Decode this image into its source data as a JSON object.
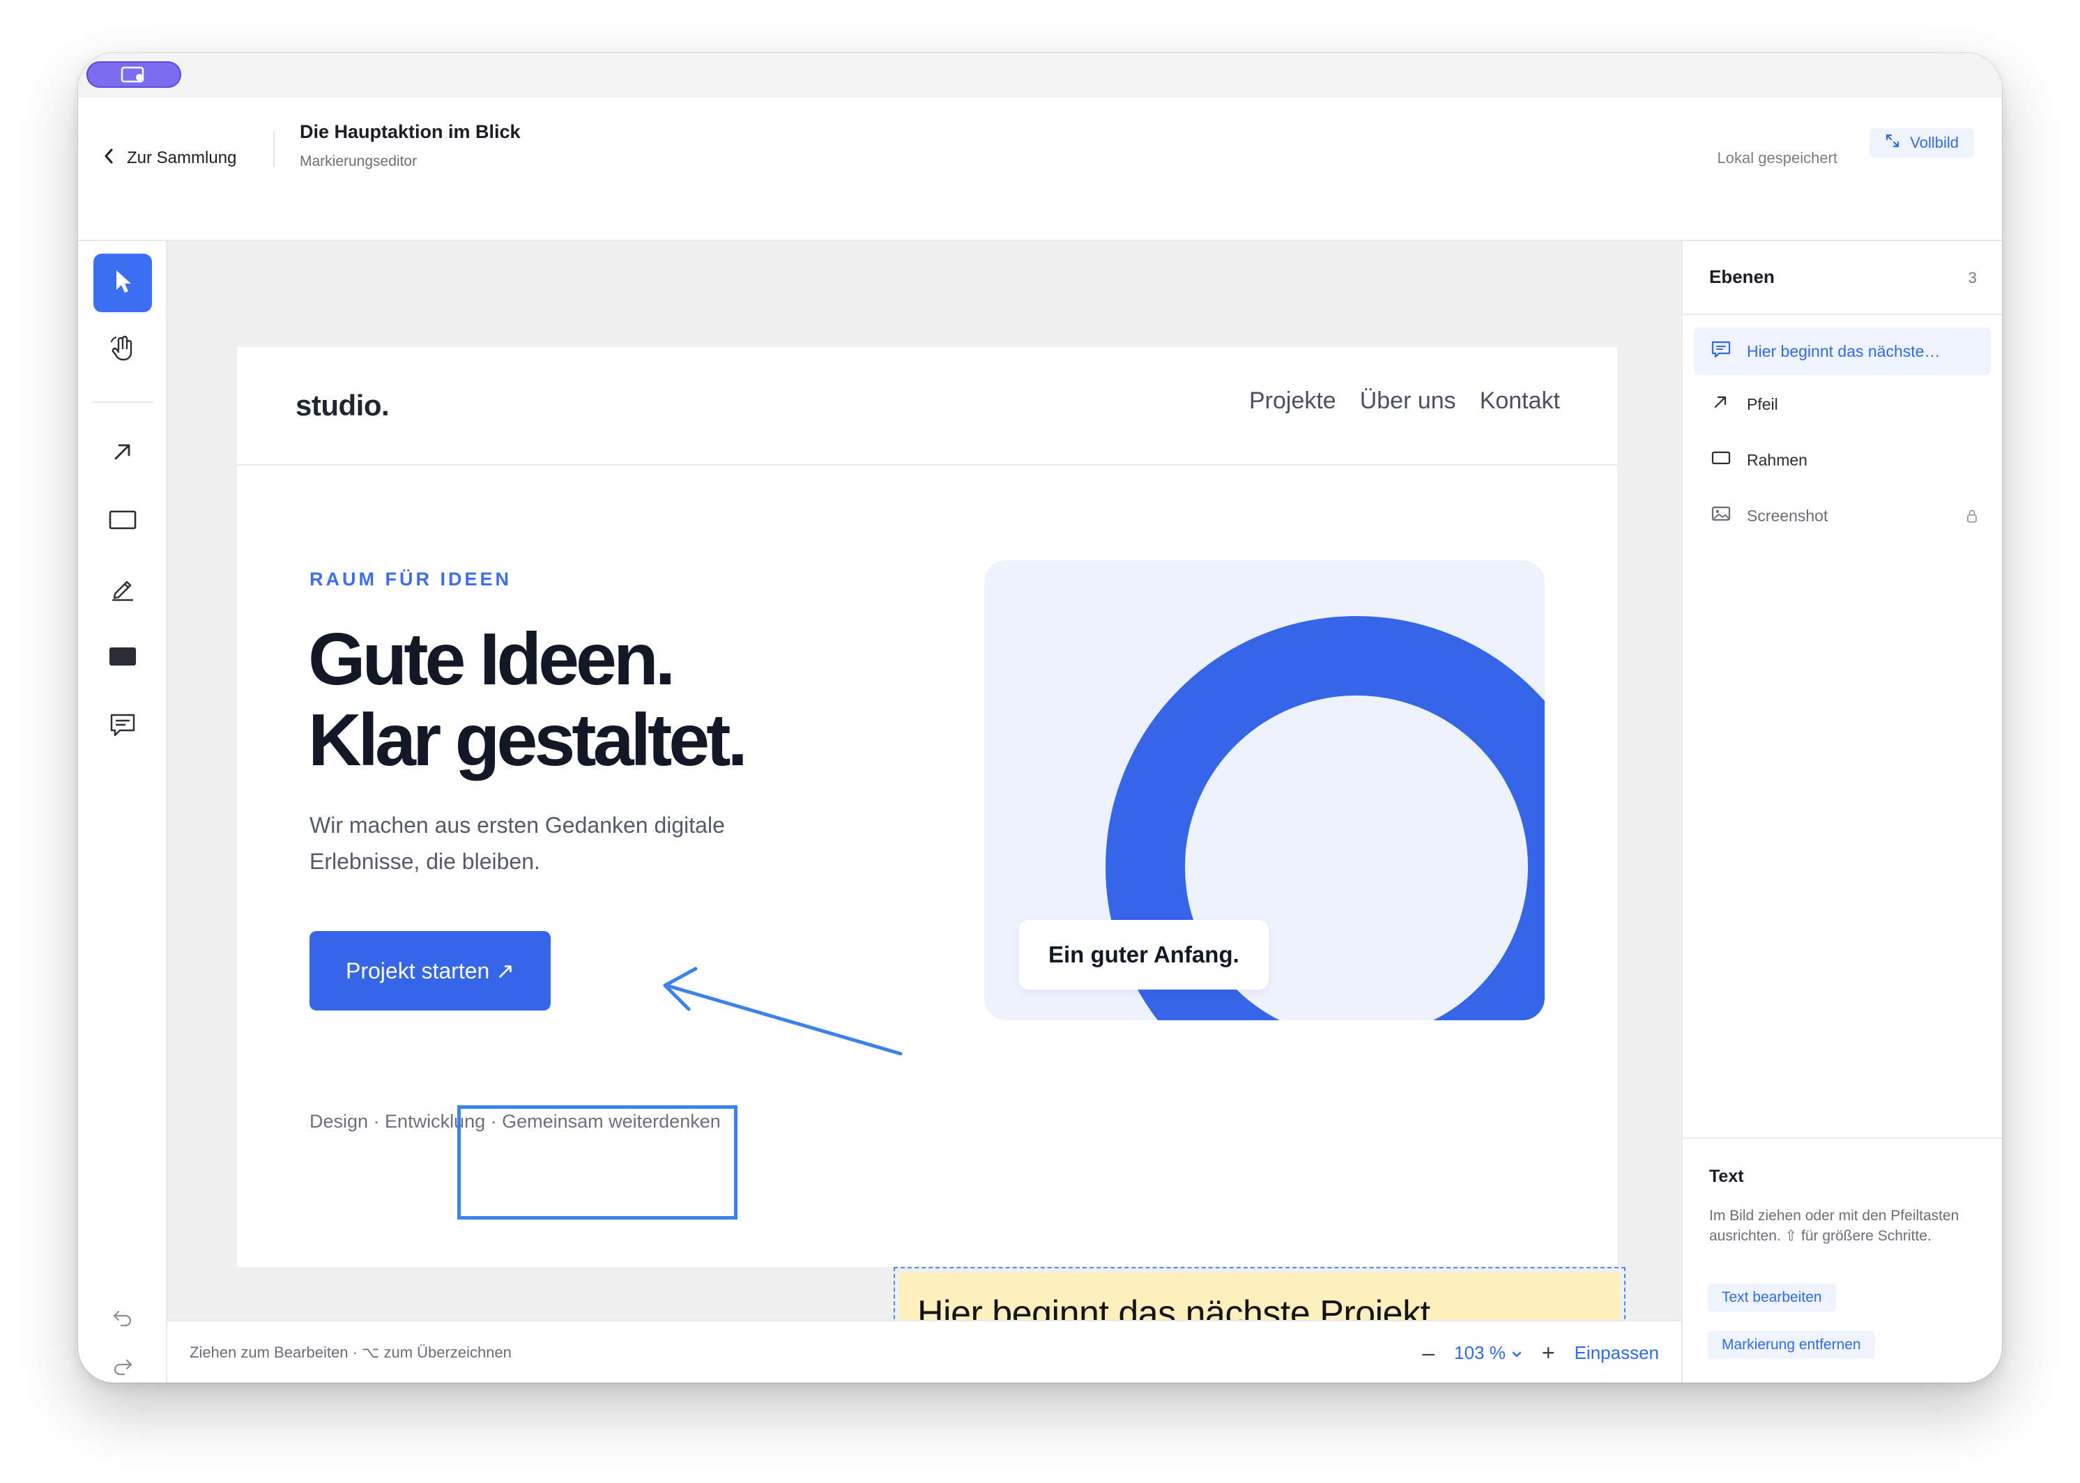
{
  "header": {
    "back_label": "Zur Sammlung",
    "doc_title": "Die Hauptaktion im Blick",
    "doc_subtitle": "Markierungseditor",
    "save_status": "Lokal gespeichert",
    "fullscreen_label": "Vollbild"
  },
  "tools": [
    {
      "name": "select",
      "icon": "cursor-icon",
      "active": true
    },
    {
      "name": "pan",
      "icon": "hand-icon",
      "active": false
    },
    {
      "name": "arrow",
      "icon": "arrow-icon",
      "active": false
    },
    {
      "name": "rectangle",
      "icon": "rectangle-icon",
      "active": false
    },
    {
      "name": "pen",
      "icon": "pen-icon",
      "active": false
    },
    {
      "name": "redact",
      "icon": "filled-rectangle-icon",
      "active": false
    },
    {
      "name": "comment",
      "icon": "comment-icon",
      "active": false
    }
  ],
  "page": {
    "brand": "studio.",
    "nav": [
      "Projekte",
      "Über uns",
      "Kontakt"
    ],
    "eyebrow": "RAUM FÜR IDEEN",
    "headline_line1": "Gute Ideen.",
    "headline_line2": "Klar gestaltet.",
    "lead": "Wir machen aus ersten Gedanken digitale Erlebnisse, die bleiben.",
    "cta_label": "Projekt starten ↗",
    "footer": "Design · Entwicklung · Gemeinsam weiterdenken",
    "hero_caption": "Ein guter Anfang."
  },
  "annotation": {
    "text": "Hier beginnt das nächste Projekt."
  },
  "status": {
    "hint": "Ziehen zum Bearbeiten · ⌥ zum Überzeichnen",
    "zoom_out": "–",
    "zoom_value": "103 %",
    "zoom_in": "+",
    "fit_label": "Einpassen"
  },
  "layers": {
    "title": "Ebenen",
    "count": "3",
    "items": [
      {
        "label": "Hier beginnt das nächste…",
        "icon": "comment-icon",
        "selected": true
      },
      {
        "label": "Pfeil",
        "icon": "arrow-icon"
      },
      {
        "label": "Rahmen",
        "icon": "rectangle-icon"
      },
      {
        "label": "Screenshot",
        "icon": "image-icon",
        "locked": true
      }
    ]
  },
  "properties": {
    "title": "Text",
    "hint": "Im Bild ziehen oder mit den Pfeiltasten ausrichten. ⇧ für größere Schritte.",
    "edit_label": "Text bearbeiten",
    "remove_label": "Markierung entfernen"
  },
  "colors": {
    "accent": "#3b6ef0",
    "annotation_stroke": "#3b82ea",
    "annotation_fill": "#fdf0bd"
  }
}
